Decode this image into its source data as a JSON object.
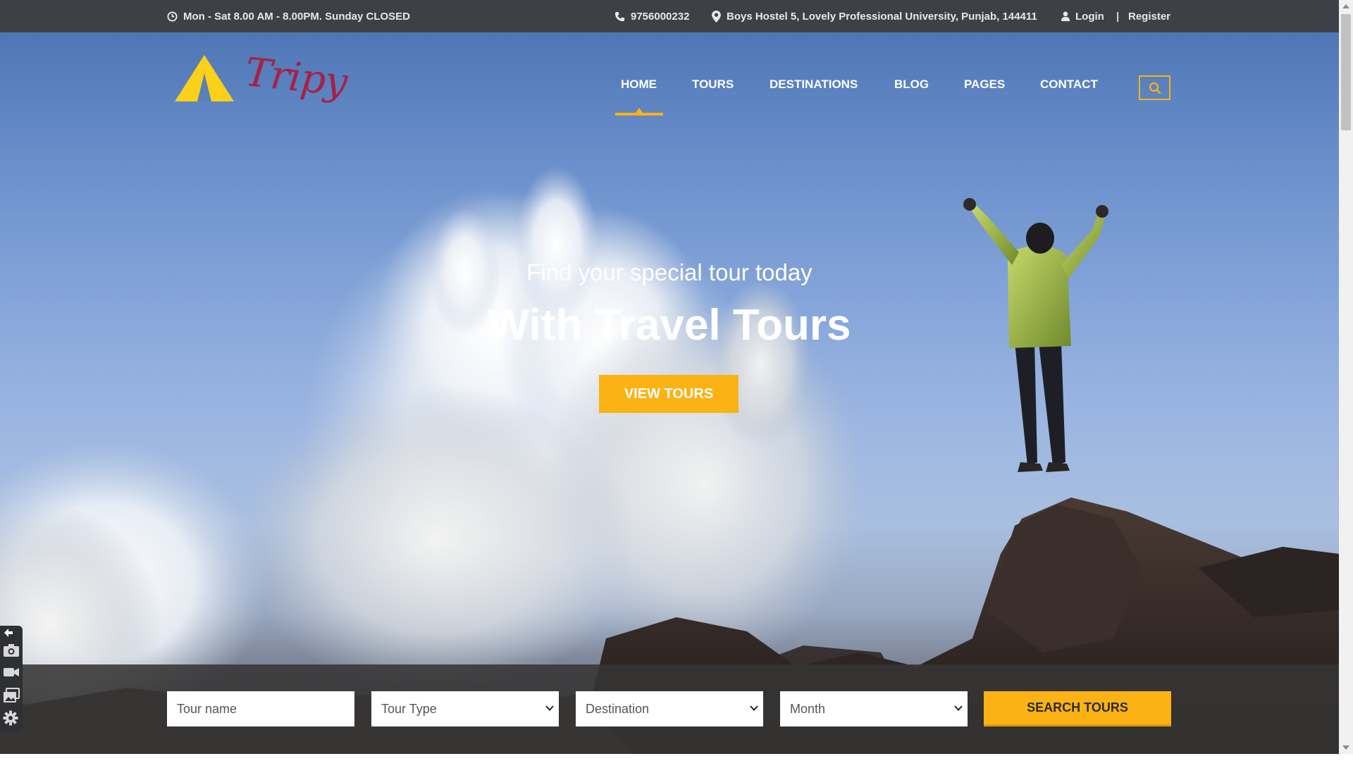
{
  "topbar": {
    "hours": "Mon - Sat 8.00 AM - 8.00PM. Sunday CLOSED",
    "phone": "9756000232",
    "address": "Boys Hostel 5, Lovely Professional University, Punjab, 144411",
    "login": "Login",
    "separator": "|",
    "register": "Register",
    "icons": [
      "clock-icon",
      "phone-icon",
      "map-pin-icon",
      "user-icon"
    ]
  },
  "brand": {
    "logo_text": "Tripy",
    "logo_color": "#a52246",
    "triangle_color": "#fbd018"
  },
  "nav": {
    "items": [
      "HOME",
      "TOURS",
      "DESTINATIONS",
      "BLOG",
      "PAGES",
      "CONTACT"
    ],
    "active": "HOME",
    "search_icon": "search-icon"
  },
  "hero": {
    "subtitle": "Find your special tour today",
    "title": "With Travel Tours",
    "button": "VIEW TOURS"
  },
  "search": {
    "tour_name_placeholder": "Tour name",
    "tour_type": "Tour Type",
    "destination": "Destination",
    "month": "Month",
    "button": "SEARCH TOURS"
  },
  "widget": {
    "icons": [
      "expand-icon",
      "camera-icon",
      "video-icon",
      "gallery-icon",
      "gear-icon"
    ]
  },
  "colors": {
    "accent": "#fbb215",
    "topbar": "#3d4147",
    "search_band": "#373434"
  }
}
